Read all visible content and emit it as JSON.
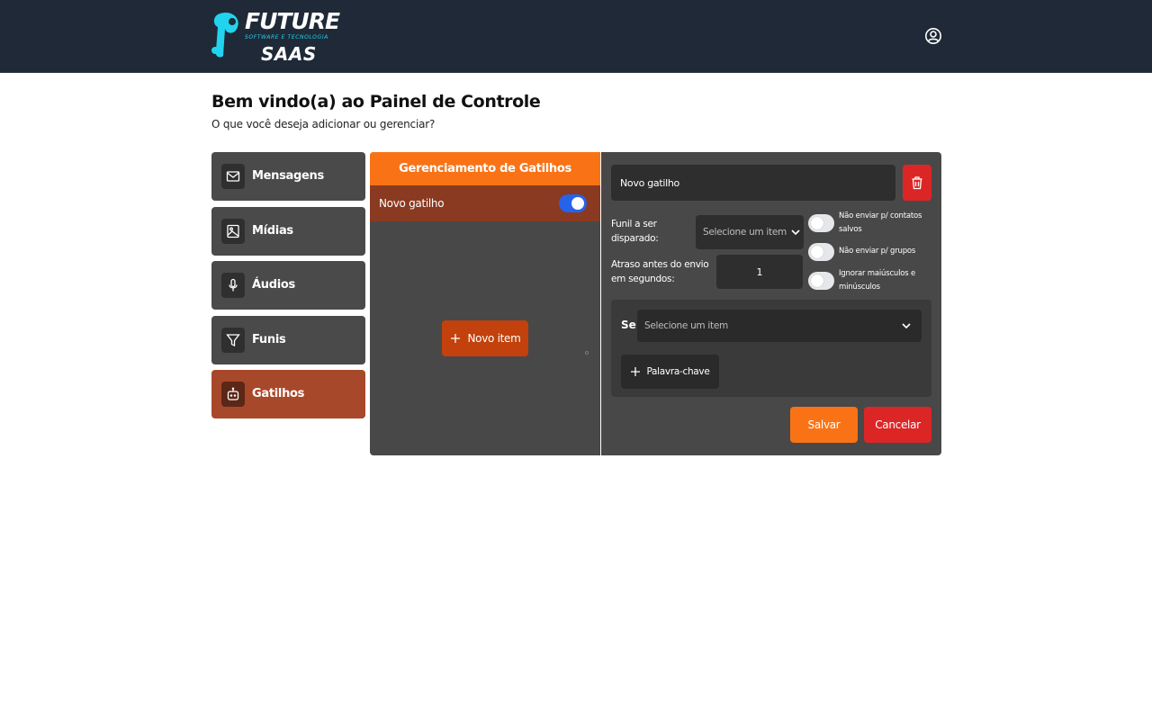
{
  "header": {
    "logo_main": "FUTURE",
    "logo_sub": "SOFTWARE E TECNOLOGIA",
    "logo_saas": "SAAS",
    "user_icon": "user-circle-icon"
  },
  "page": {
    "title": "Bem vindo(a) ao Painel de Controle",
    "subtitle": "O que você deseja adicionar ou gerenciar?"
  },
  "sidebar": {
    "items": [
      {
        "label": "Mensagens",
        "icon": "mail-icon",
        "active": false
      },
      {
        "label": "Mídias",
        "icon": "image-icon",
        "active": false
      },
      {
        "label": "Áudios",
        "icon": "mic-icon",
        "active": false
      },
      {
        "label": "Funis",
        "icon": "filter-icon",
        "active": false
      },
      {
        "label": "Gatilhos",
        "icon": "bot-icon",
        "active": true
      }
    ]
  },
  "triggers_panel": {
    "title": "Gerenciamento de Gatilhos",
    "items": [
      {
        "label": "Novo gatilho",
        "enabled": true
      }
    ],
    "new_item_label": "Novo item"
  },
  "editor": {
    "name_value": "Novo gatilho",
    "funnel_label_line1": "Funil a ser",
    "funnel_label_line2": "disparado:",
    "funnel_placeholder": "Selecione um item",
    "delay_label_line1": "Atraso antes do envio",
    "delay_label_line2": "em segundos:",
    "delay_value": "1",
    "options": [
      {
        "line1": "Não enviar p/ contatos",
        "line2": "salvos",
        "enabled": false
      },
      {
        "line1": "Não enviar p/ grupos",
        "line2": "",
        "enabled": false
      },
      {
        "line1": "Ignorar maiúsculos e",
        "line2": "minúsculos",
        "enabled": false
      }
    ],
    "condition_label": "Se",
    "condition_placeholder": "Selecione um item",
    "keyword_button": "Palavra-chave",
    "save_label": "Salvar",
    "cancel_label": "Cancelar"
  },
  "colors": {
    "header_bg": "#1f2937",
    "accent_orange": "#f97316",
    "active_item": "#a8482a",
    "danger_red": "#dc2626",
    "toggle_blue": "#2563eb",
    "panel_gray": "#484848"
  }
}
